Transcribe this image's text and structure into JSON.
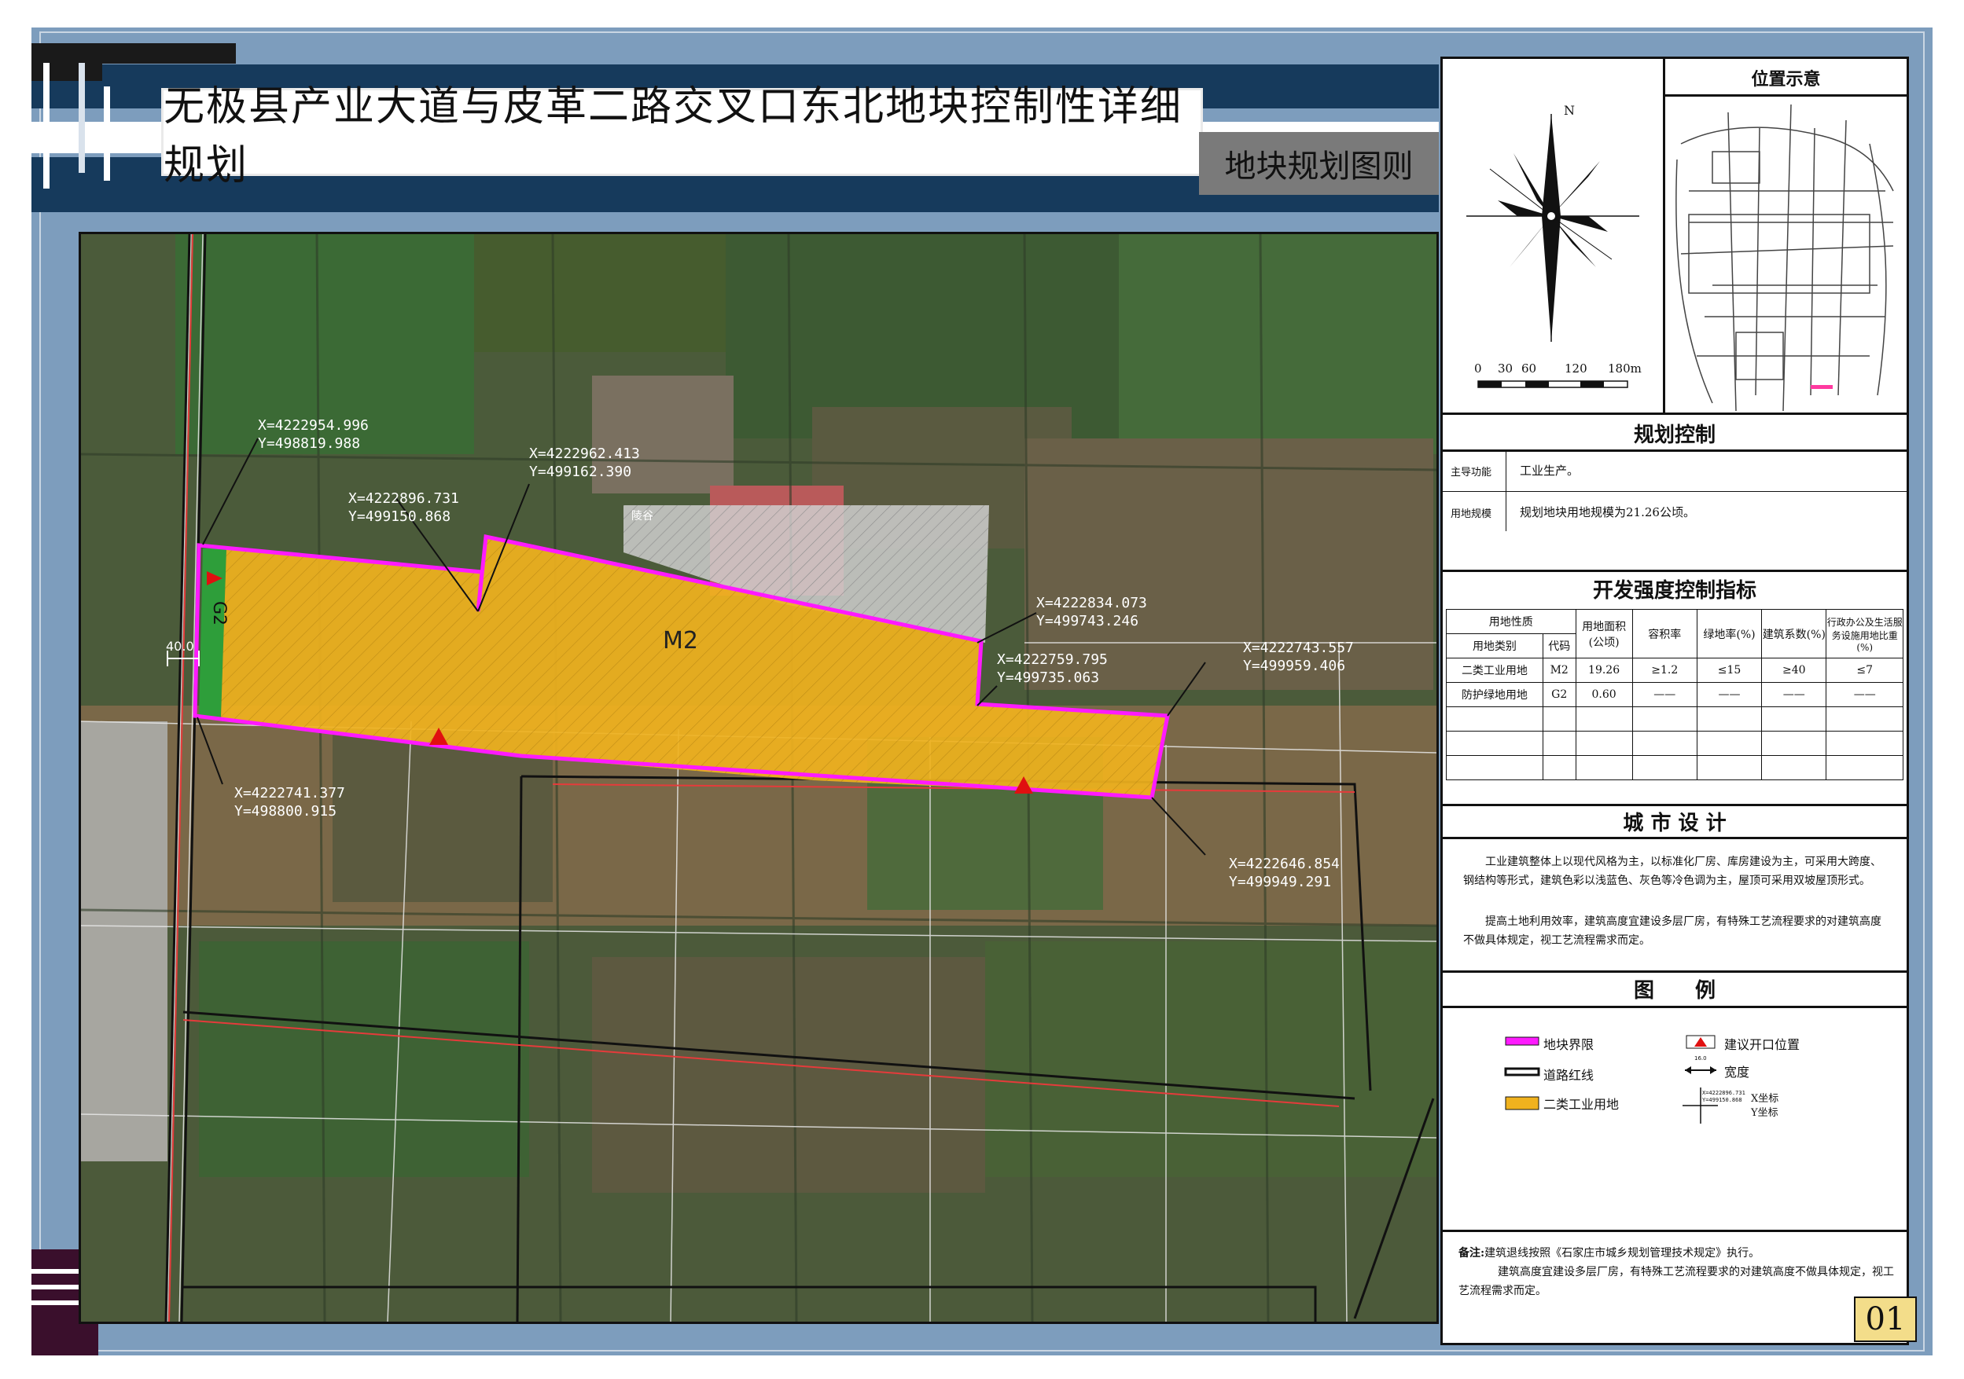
{
  "title": "无极县产业大道与皮革二路交叉口东北地块控制性详细规划",
  "subtitle": "地块规划图则",
  "page_number": "01",
  "colors": {
    "frame": "#7d9dbd",
    "band": "#163a5c",
    "boundary": "#ff1aff",
    "industrial": "#f0b21e",
    "green": "#2e9e3a",
    "opening": "#e01010",
    "road_red": "#e53b3b"
  },
  "map": {
    "parcel_label": "M2",
    "green_label": "G2",
    "width_label": "40.0",
    "coords": [
      {
        "x": "X=4222954.996",
        "y": "Y=498819.988"
      },
      {
        "x": "X=4222962.413",
        "y": "Y=499162.390"
      },
      {
        "x": "X=4222896.731",
        "y": "Y=499150.868"
      },
      {
        "x": "X=4222834.073",
        "y": "Y=499743.246"
      },
      {
        "x": "X=4222759.795",
        "y": "Y=499735.063"
      },
      {
        "x": "X=4222743.557",
        "y": "Y=499959.406"
      },
      {
        "x": "X=4222741.377",
        "y": "Y=498800.915"
      },
      {
        "x": "X=4222646.854",
        "y": "Y=499949.291"
      }
    ],
    "hatched_label": "陵谷"
  },
  "location": {
    "heading": "位置示意",
    "north": "N",
    "scale_labels": [
      "0",
      "30",
      "60",
      "120",
      "180m"
    ]
  },
  "planning_control": {
    "heading": "规划控制",
    "rows": [
      {
        "label": "主导功能",
        "value": "工业生产。"
      },
      {
        "label": "用地规模",
        "value": "规划地块用地规模为21.26公顷。"
      }
    ]
  },
  "intensity": {
    "heading": "开发强度控制指标",
    "headers": [
      "用地性质",
      "用地面积(公顷)",
      "容积率",
      "绿地率(%)",
      "建筑系数(%)",
      "行政办公及生活服务设施用地比重(%)"
    ],
    "subheaders": [
      "用地类别",
      "代码"
    ],
    "rows": [
      [
        "二类工业用地",
        "M2",
        "19.26",
        "≥1.2",
        "≤15",
        "≥40",
        "≤7"
      ],
      [
        "防护绿地用地",
        "G2",
        "0.60",
        "——",
        "——",
        "——",
        "——"
      ]
    ]
  },
  "urban_design": {
    "heading": "城 市 设 计",
    "p1": "工业建筑整体上以现代风格为主，以标准化厂房、库房建设为主，可采用大跨度、钢结构等形式，建筑色彩以浅蓝色、灰色等冷色调为主，屋顶可采用双坡屋顶形式。",
    "p2": "提高土地利用效率，建筑高度宜建设多层厂房，有特殊工艺流程要求的对建筑高度不做具体规定，视工艺流程需求而定。"
  },
  "legend": {
    "heading": "图　　例",
    "items": [
      "地块界限",
      "建议开口位置",
      "道路红线",
      "宽度",
      "二类工业用地",
      "X坐标",
      "Y坐标"
    ],
    "width_sample": "16.0",
    "coord_sample_x": "X=4222896.731",
    "coord_sample_y": "Y=499150.868"
  },
  "notes": {
    "label": "备注:",
    "line1": "建筑退线按照《石家庄市城乡规划管理技术规定》执行。",
    "line2": "建筑高度宜建设多层厂房，有特殊工艺流程要求的对建筑高度不做具体规定，视工艺流程需求而定。"
  }
}
